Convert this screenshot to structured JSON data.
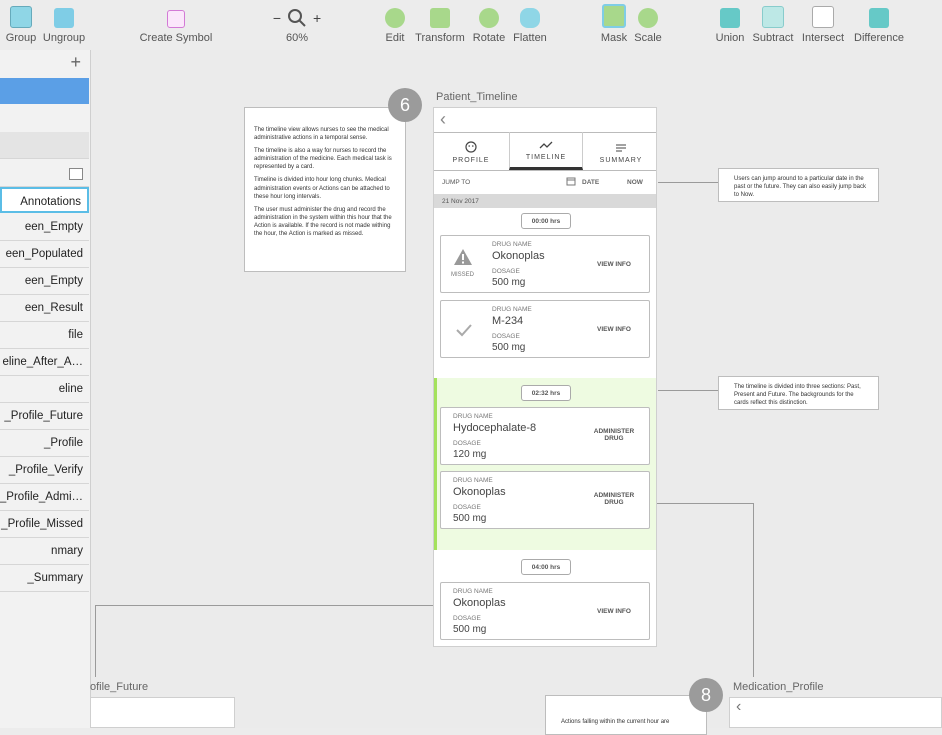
{
  "toolbar": {
    "items": [
      {
        "label": "Group"
      },
      {
        "label": "Ungroup"
      },
      {
        "label": "Create Symbol"
      },
      {
        "label": "60%"
      },
      {
        "label": "Edit"
      },
      {
        "label": "Transform"
      },
      {
        "label": "Rotate"
      },
      {
        "label": "Flatten"
      },
      {
        "label": "Mask"
      },
      {
        "label": "Scale"
      },
      {
        "label": "Union"
      },
      {
        "label": "Subtract"
      },
      {
        "label": "Intersect"
      },
      {
        "label": "Difference"
      }
    ],
    "zoom_minus": "−",
    "zoom_plus": "+"
  },
  "sidebar": {
    "add": "+",
    "items": [
      "Annotations",
      "een_Empty",
      "een_Populated",
      "een_Empty",
      "een_Result",
      "file",
      "eline_After_A…",
      "eline",
      "_Profile_Future",
      "_Profile",
      "_Profile_Verify",
      "_Profile_Admi…",
      "_Profile_Missed",
      "nmary",
      "_Summary"
    ]
  },
  "artboards": {
    "main_title": "Patient_Timeline",
    "left_bottom": "ofile_Future",
    "right_bottom": "Medication_Profile",
    "badge_main": "6",
    "badge_right": "8"
  },
  "note_left": [
    "The timeline view allows nurses to see the medical administrative actions in a temporal sense.",
    "The timeline is also a way for nurses to record the administration of the medicine. Each medical task is represented by a card.",
    "Timeline is divided into hour long chunks. Medical administration events or Actions can be attached to these hour long intervals.",
    "The user must administer the drug and record the administration in the system within this hour that the Action is available. If the record is not made withing the hour, the Action is marked as missed."
  ],
  "note_jump": "Users can jump around to a particular date in the past or the future. They can also easily jump back to Now.",
  "note_sections": "The timeline is divided into three sections: Past, Present and Future. The backgrounds for the cards reflect this distinction.",
  "note_bottom": "Actions falling within the current hour are",
  "phone": {
    "back": "‹",
    "tabs": [
      "PROFILE",
      "TIMELINE",
      "SUMMARY"
    ],
    "jump_to": "JUMP TO",
    "date": "DATE",
    "now": "NOW",
    "date_header": "21 Nov 2017",
    "hours": [
      "00:00 hrs",
      "02:32 hrs",
      "04:00 hrs"
    ],
    "drug_name_label": "DRUG NAME",
    "dosage_label": "DOSAGE",
    "missed": "MISSED",
    "cards": [
      {
        "name": "Okonoplas",
        "dose": "500 mg",
        "action": "VIEW INFO"
      },
      {
        "name": "M-234",
        "dose": "500 mg",
        "action": "VIEW INFO"
      },
      {
        "name": "Hydocephalate-8",
        "dose": "120 mg",
        "action": "ADMINISTER DRUG"
      },
      {
        "name": "Okonoplas",
        "dose": "500 mg",
        "action": "ADMINISTER DRUG"
      },
      {
        "name": "Okonoplas",
        "dose": "500 mg",
        "action": "VIEW INFO"
      }
    ]
  },
  "bottom_right_phone": {
    "back": "‹"
  },
  "colors": {
    "present_bg": "#eefbe1",
    "present_bar": "#a4e25c",
    "badge": "#9b9b9b"
  }
}
